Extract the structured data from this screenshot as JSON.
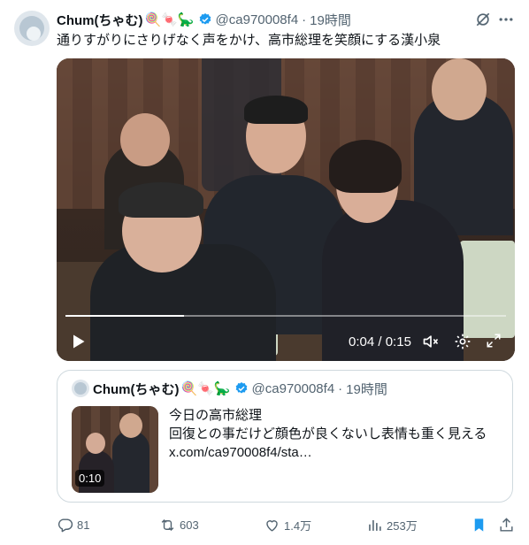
{
  "author": {
    "display_name": "Chum(ちゃむ)",
    "emojis": "🍭🍬🦕",
    "handle": "@ca970008f4",
    "separator": "·",
    "time": "19時間"
  },
  "tweet": {
    "text": "通りすがりにさりげなく声をかけ、高市総理を笑顔にする漢小泉"
  },
  "video": {
    "progress": 0.27,
    "time_current": "0:04",
    "time_sep": "/",
    "time_total": "0:15"
  },
  "quote": {
    "display_name": "Chum(ちゃむ)",
    "emojis": "🍭🍬🦕",
    "handle": "@ca970008f4",
    "separator": "·",
    "time": "19時間",
    "line1": "今日の高市総理",
    "line2": "回復との事だけど顔色が良くないし表情も重く見える",
    "line3": "x.com/ca970008f4/sta…",
    "duration": "0:10"
  },
  "actions": {
    "replies": "81",
    "reposts": "603",
    "likes": "1.4万",
    "views": "253万"
  },
  "colors": {
    "verified": "#1d9bf0",
    "bookmark_active": "#1d9bf0",
    "text": "#0f1419",
    "muted": "#536471"
  },
  "icons": [
    "grok-icon",
    "more-icon",
    "play-icon",
    "volume-icon",
    "settings-icon",
    "fullscreen-icon",
    "reply-icon",
    "repost-icon",
    "like-icon",
    "views-icon",
    "bookmark-icon",
    "share-icon"
  ]
}
